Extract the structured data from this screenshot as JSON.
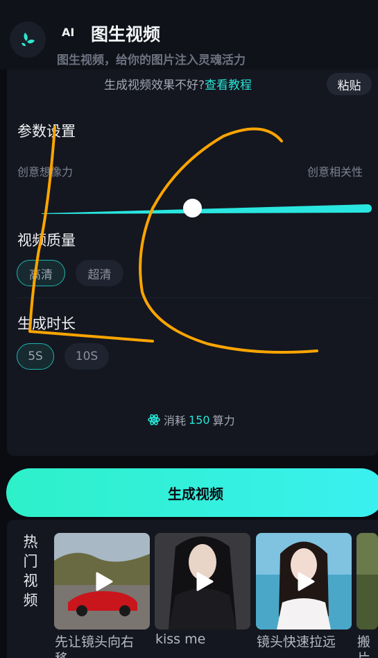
{
  "header": {
    "ai_tag": "AI",
    "title": "图生视频",
    "subtitle": "图生视频，给你的图片注入灵魂活力"
  },
  "tip": {
    "text": "生成视频效果不好?",
    "link": "查看教程",
    "paste_label": "粘贴"
  },
  "params": {
    "title": "参数设置",
    "left_label": "创意想像力",
    "right_label": "创意相关性",
    "slider_value_fraction": 0.45
  },
  "quality": {
    "title": "视频质量",
    "options": [
      "高清",
      "超清"
    ],
    "selected": "高清"
  },
  "duration": {
    "title": "生成时长",
    "options": [
      "5S",
      "10S"
    ],
    "selected": "5S"
  },
  "cost": {
    "prefix": "消耗",
    "amount": "150",
    "suffix": "算力"
  },
  "generate_label": "生成视频",
  "hot": {
    "label": "热门视频",
    "items": [
      {
        "caption": "先让镜头向右",
        "caption2": "移"
      },
      {
        "caption": "kiss me"
      },
      {
        "caption": "镜头快速拉远"
      },
      {
        "caption": "搬",
        "caption2": "片"
      }
    ]
  },
  "colors": {
    "accent": "#26e6d8",
    "background": "#0a0c12",
    "panel": "#141720",
    "annotation": "#ffa500"
  }
}
